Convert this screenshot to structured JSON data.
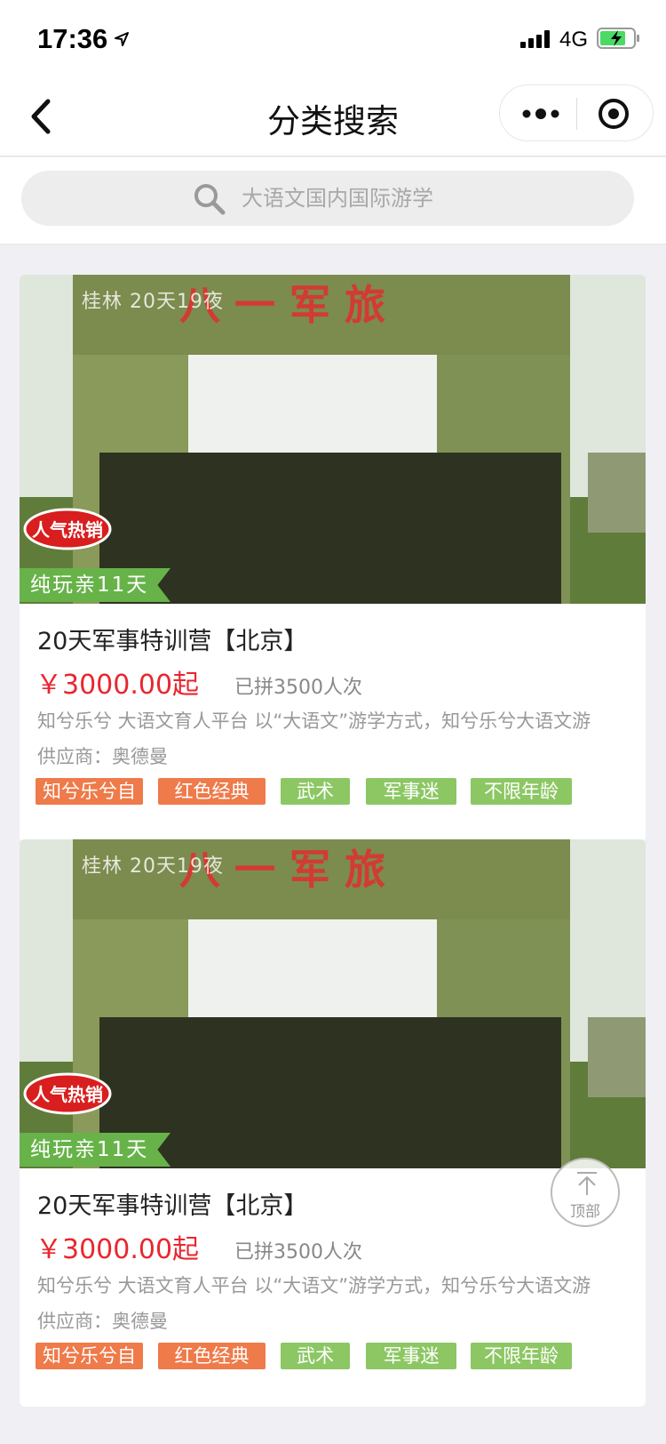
{
  "status_bar": {
    "time": "17:36",
    "network": "4G"
  },
  "nav": {
    "title": "分类搜索"
  },
  "search": {
    "placeholder": "大语文国内国际游学"
  },
  "cards": [
    {
      "image_caption": "桂林 20天19夜",
      "hot_badge": "人气热销",
      "ribbon": "纯玩亲11天",
      "title": "20天军事特训营【北京】",
      "price": "￥3000.00起",
      "sold": "已拼3500人次",
      "desc": "知兮乐兮 大语文育人平台 以“大语文”游学方式，知兮乐兮大语文游",
      "supplier": "供应商：奥德曼",
      "tags": [
        "知兮乐兮自营",
        "红色经典",
        "武术",
        "军事迷",
        "不限年龄"
      ]
    },
    {
      "image_caption": "桂林 20天19夜",
      "hot_badge": "人气热销",
      "ribbon": "纯玩亲11天",
      "title": "20天军事特训营【北京】",
      "price": "￥3000.00起",
      "sold": "已拼3500人次",
      "desc": "知兮乐兮 大语文育人平台 以“大语文”游学方式，知兮乐兮大语文游",
      "supplier": "供应商：奥德曼",
      "tags": [
        "知兮乐兮自营",
        "红色经典",
        "武术",
        "军事迷",
        "不限年龄"
      ]
    }
  ],
  "back_to_top": {
    "label": "顶部"
  },
  "colors": {
    "price": "#e9262f",
    "tag_orange": "#ef7a4a",
    "tag_green": "#8cc764",
    "ribbon": "#67b349"
  }
}
